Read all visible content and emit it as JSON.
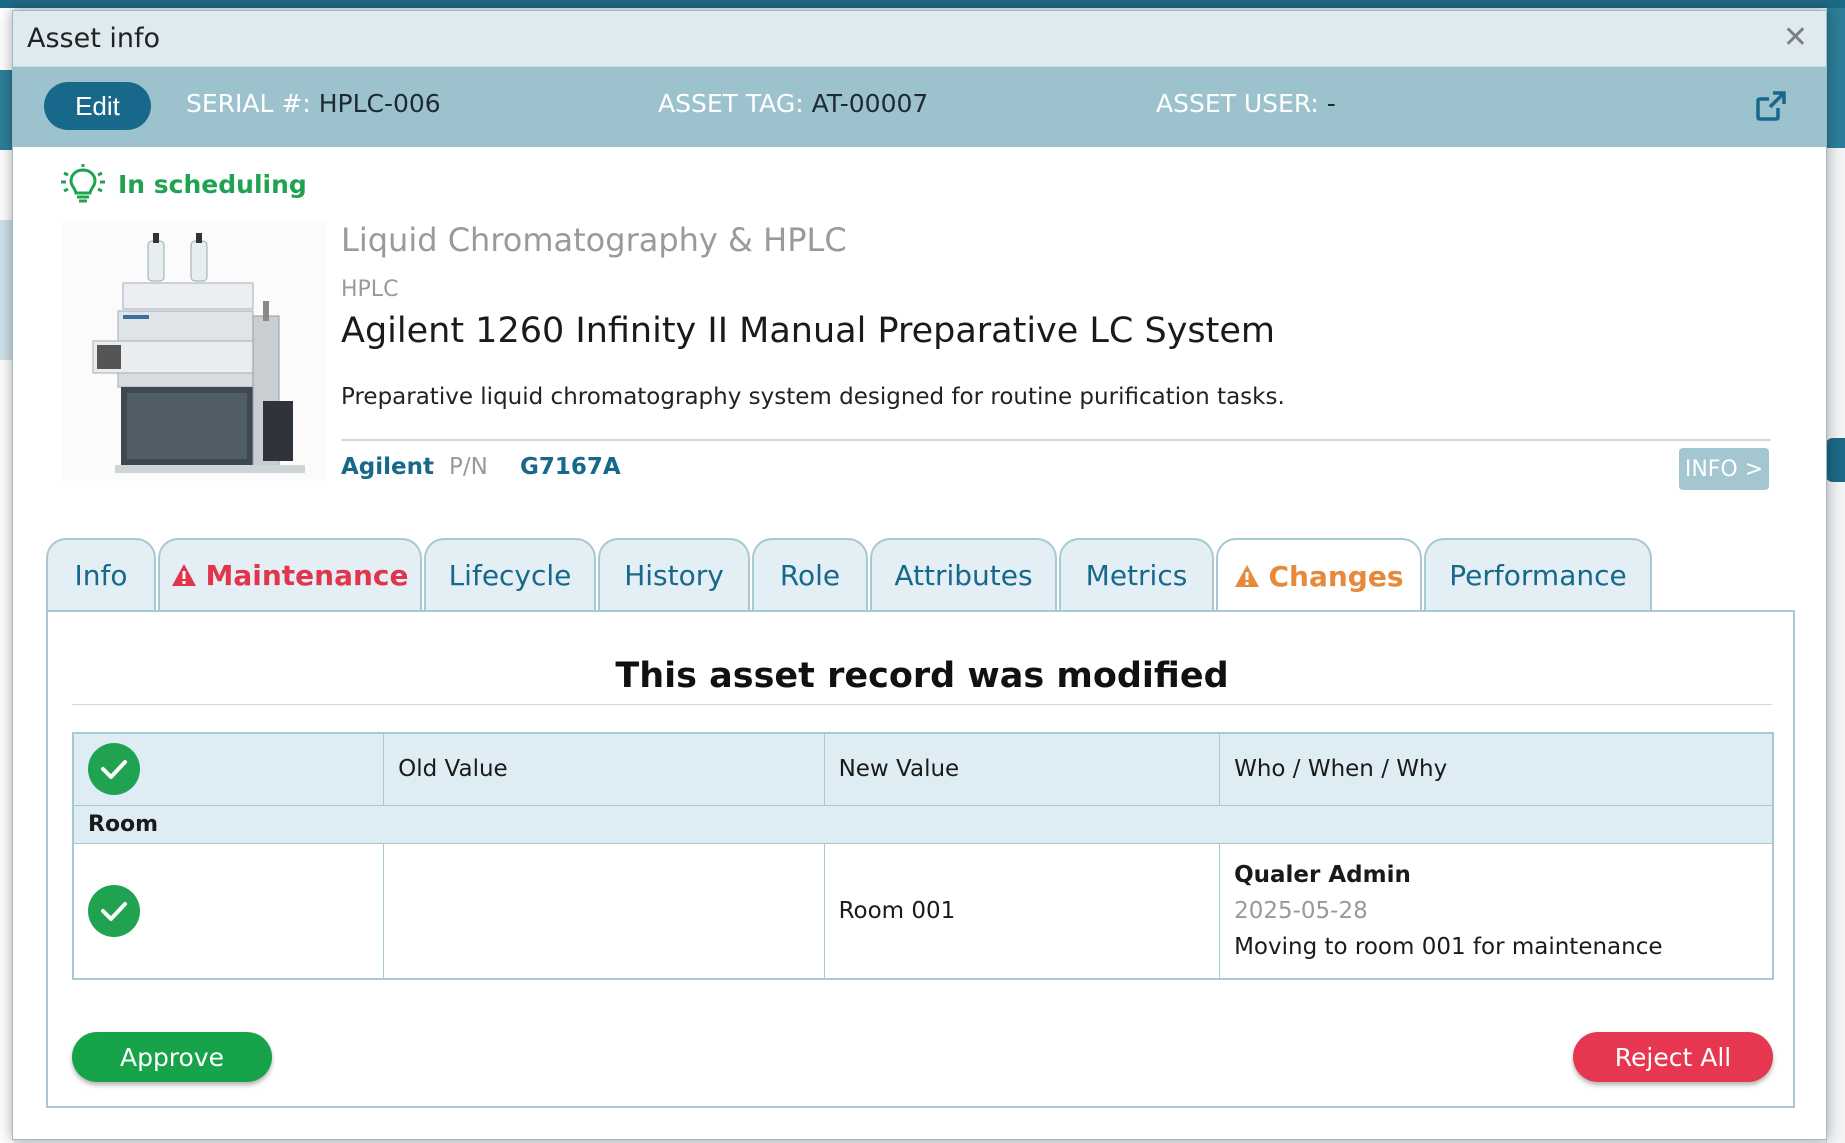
{
  "modal": {
    "title": "Asset info"
  },
  "infobar": {
    "edit_label": "Edit",
    "serial_label": "SERIAL #:",
    "serial_value": "HPLC-006",
    "asset_tag_label": "ASSET TAG:",
    "asset_tag_value": "AT-00007",
    "asset_user_label": "ASSET USER:",
    "asset_user_value": "-"
  },
  "status": {
    "label": "In scheduling",
    "color": "#1fa351"
  },
  "asset": {
    "category": "Liquid Chromatography & HPLC",
    "subcategory": "HPLC",
    "name": "Agilent 1260 Infinity II Manual Preparative LC System",
    "description": "Preparative liquid chromatography system designed for routine purification tasks.",
    "manufacturer": "Agilent",
    "pn_label": "P/N",
    "pn_value": "G7167A",
    "info_button": "INFO >"
  },
  "tabs": [
    {
      "label": "Info",
      "warning": null
    },
    {
      "label": "Maintenance",
      "warning": "red"
    },
    {
      "label": "Lifecycle",
      "warning": null
    },
    {
      "label": "History",
      "warning": null
    },
    {
      "label": "Role",
      "warning": null
    },
    {
      "label": "Attributes",
      "warning": null
    },
    {
      "label": "Metrics",
      "warning": null
    },
    {
      "label": "Changes",
      "warning": "orange",
      "active": true
    },
    {
      "label": "Performance",
      "warning": null
    }
  ],
  "changes": {
    "heading": "This asset record was modified",
    "columns": {
      "old": "Old Value",
      "new": "New Value",
      "who": "Who / When / Why"
    },
    "groups": [
      {
        "name": "Room",
        "rows": [
          {
            "old_value": "",
            "new_value": "Room 001",
            "who": "Qualer Admin",
            "when": "2025-05-28",
            "why": "Moving to room 001 for maintenance"
          }
        ]
      }
    ],
    "approve_label": "Approve",
    "reject_label": "Reject All"
  },
  "colors": {
    "primary": "#17688a",
    "approve": "#16a34a",
    "reject": "#e7364f",
    "warn_red": "#e0354b",
    "warn_orange": "#e6893a"
  }
}
